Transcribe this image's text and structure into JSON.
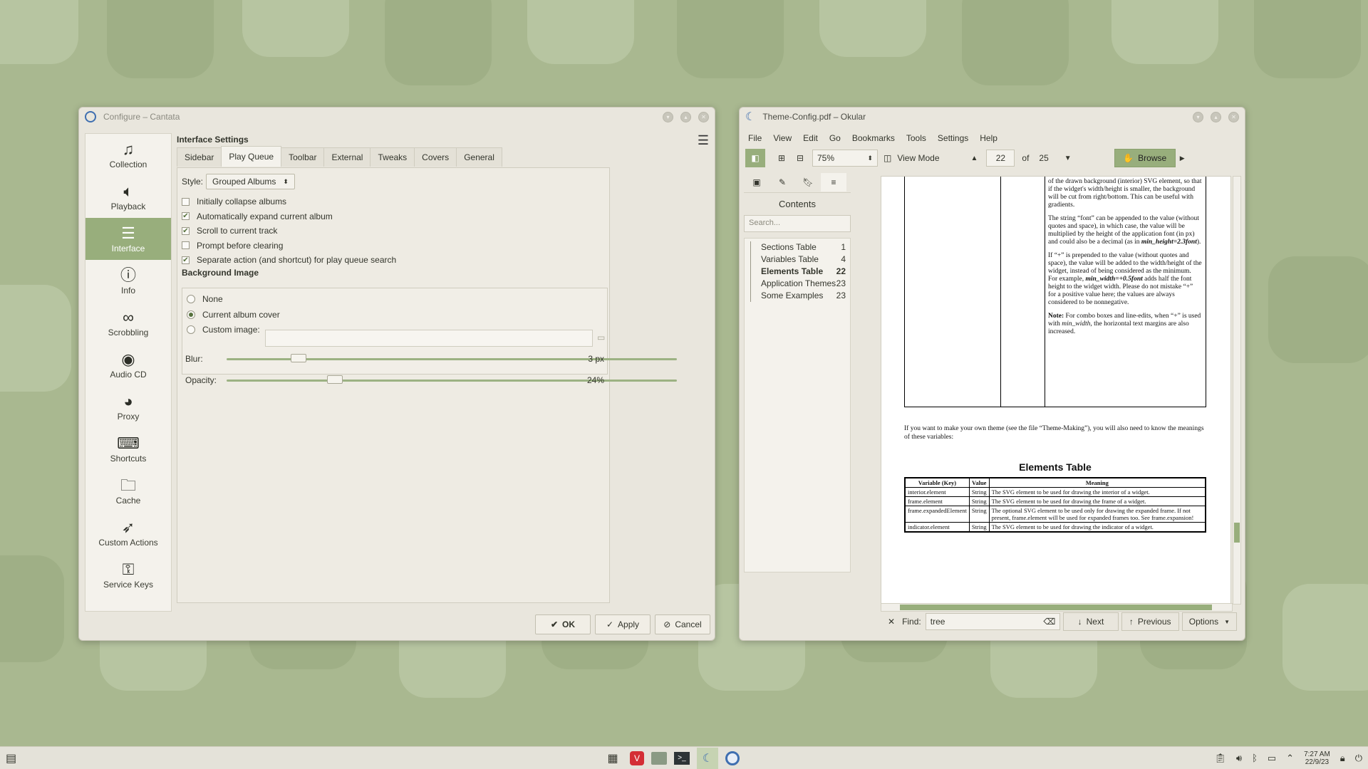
{
  "cantata": {
    "title": "Configure – Cantata",
    "sidebar": [
      {
        "label": "Collection",
        "icon": "music-note-icon"
      },
      {
        "label": "Playback",
        "icon": "speaker-icon"
      },
      {
        "label": "Interface",
        "icon": "sliders-icon"
      },
      {
        "label": "Info",
        "icon": "info-icon"
      },
      {
        "label": "Scrobbling",
        "icon": "lastfm-icon"
      },
      {
        "label": "Audio CD",
        "icon": "cd-icon"
      },
      {
        "label": "Proxy",
        "icon": "globe-icon"
      },
      {
        "label": "Shortcuts",
        "icon": "keyboard-icon"
      },
      {
        "label": "Cache",
        "icon": "folder-icon"
      },
      {
        "label": "Custom Actions",
        "icon": "rocket-icon"
      },
      {
        "label": "Service Keys",
        "icon": "keys-icon"
      }
    ],
    "selected": "Interface",
    "panel_title": "Interface Settings",
    "tabs": [
      "Sidebar",
      "Play Queue",
      "Toolbar",
      "External",
      "Tweaks",
      "Covers",
      "General"
    ],
    "active_tab": "Play Queue",
    "style_label": "Style:",
    "style_value": "Grouped Albums",
    "checkboxes": [
      {
        "label": "Initially collapse albums",
        "checked": false
      },
      {
        "label": "Automatically expand current album",
        "checked": true
      },
      {
        "label": "Scroll to current track",
        "checked": true
      },
      {
        "label": "Prompt before clearing",
        "checked": false
      },
      {
        "label": "Separate action (and shortcut) for play queue search",
        "checked": true
      }
    ],
    "bg_title": "Background Image",
    "radios": [
      {
        "label": "None",
        "checked": false
      },
      {
        "label": "Current album cover",
        "checked": true
      },
      {
        "label": "Custom image:",
        "checked": false
      }
    ],
    "blur_label": "Blur:",
    "blur_value": "3 px",
    "blur_level": 0.16,
    "opacity_label": "Opacity:",
    "opacity_value": "24%",
    "opacity_level": 0.24,
    "ok": "OK",
    "apply": "Apply",
    "cancel": "Cancel"
  },
  "okular": {
    "title": "Theme-Config.pdf – Okular",
    "menu": [
      "File",
      "View",
      "Edit",
      "Go",
      "Bookmarks",
      "Tools",
      "Settings",
      "Help"
    ],
    "zoom": "75%",
    "view_mode": "View Mode",
    "page": "22",
    "of": "of",
    "total": "25",
    "browse": "Browse",
    "contents_title": "Contents",
    "search_placeholder": "Search...",
    "toc": [
      {
        "label": "Sections Table",
        "page": "1"
      },
      {
        "label": "Variables Table",
        "page": "4"
      },
      {
        "label": "Elements Table",
        "page": "22"
      },
      {
        "label": "Application Themes",
        "page": "23"
      },
      {
        "label": "Some Examples",
        "page": "23"
      }
    ],
    "doc": {
      "p1": "of the drawn background (interior) SVG element, so that if the widget's width/height is smaller, the background will be cut from right/bottom. This can be useful with gradients.",
      "p2a": "The string “font” can be appended to the value (without quotes and space), in which case, the value will be multiplied by the height of the application font (in px) and could also be a decimal (as in ",
      "p2b": "min_height=2.3font",
      "p2c": ").",
      "p3a": "If “+” is prepended to the value (without quotes and space), the value will be added to the width/height of the widget, instead of being considered as the minimum. For example, ",
      "p3b": "min_width=+0.5font",
      "p3c": " adds half the font height to the widget width. Please do not mistake “+” for a positive value here; the values are always considered to be nonnegative.",
      "note_b": "Note:",
      "note": " For combo boxes and line-edits, when “+” is used with ",
      "note_i": "min_width",
      "note_c": ", the horizontal text margins are also increased.",
      "intro": "If you want to make your own theme (see the file “Theme-Making”), you will also need to know the meanings of these variables:",
      "heading": "Elements Table",
      "headers": [
        "Variable (Key)",
        "Value",
        "Meaning"
      ],
      "rows": [
        [
          "interior.element",
          "String",
          "The SVG element to be used for drawing the interior of a widget."
        ],
        [
          "frame.element",
          "String",
          "The SVG element to be used for drawing the frame of a widget."
        ],
        [
          "frame.expandedElement",
          "String",
          "The optional SVG element to be used only for drawing the expanded frame. If not present, frame.element will be used for expanded frames too. See frame.expansion!"
        ],
        [
          "indicator.element",
          "String",
          "The SVG element to be used for drawing the indicator of a widget."
        ]
      ]
    },
    "find_label": "Find:",
    "find_value": "tree",
    "next": "Next",
    "previous": "Previous",
    "options": "Options"
  },
  "taskbar": {
    "time": "7:27 AM",
    "date": "22/9/23"
  }
}
